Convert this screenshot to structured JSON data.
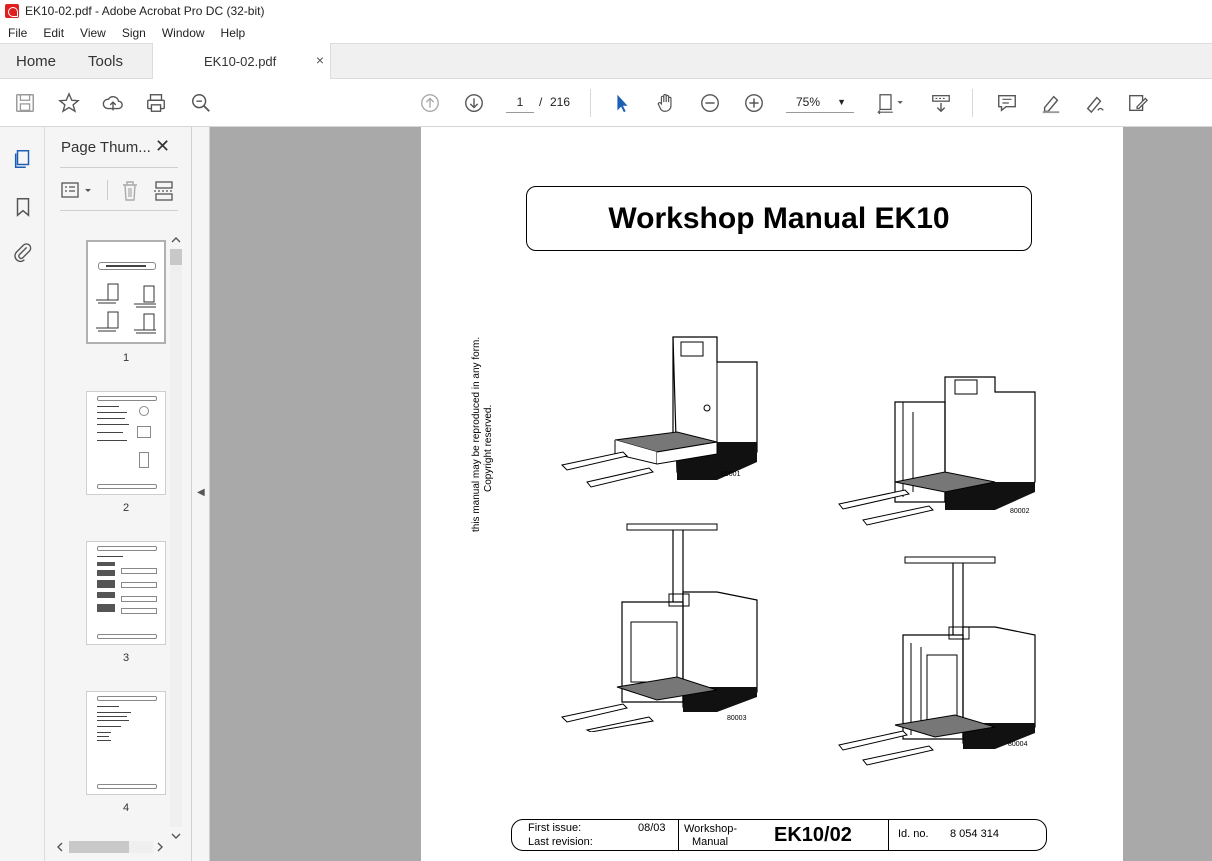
{
  "window": {
    "title": "EK10-02.pdf - Adobe Acrobat Pro DC (32-bit)"
  },
  "menu": [
    "File",
    "Edit",
    "View",
    "Sign",
    "Window",
    "Help"
  ],
  "tabs": {
    "home": "Home",
    "tools": "Tools",
    "document": "EK10-02.pdf",
    "close": "×"
  },
  "toolbar": {
    "current_page": "1",
    "page_separator": "/",
    "total_pages": "216",
    "zoom": "75%"
  },
  "thumbnails": {
    "title": "Page Thum...",
    "close": "✕",
    "pages": [
      {
        "number": "1"
      },
      {
        "number": "2"
      },
      {
        "number": "3"
      },
      {
        "number": "4"
      }
    ]
  },
  "document": {
    "title": "Workshop Manual EK10",
    "copyright_line1": "this manual may be reproduced in any form.",
    "copyright_line2": "Copyright reserved.",
    "figures": [
      {
        "label": "80001"
      },
      {
        "label": "80002"
      },
      {
        "label": "80003"
      },
      {
        "label": "80004"
      }
    ],
    "footer": {
      "first_issue_label": "First issue:",
      "first_issue_value": "08/03",
      "last_revision_label": "Last revision:",
      "doc_type_line1": "Workshop-",
      "doc_type_line2": "Manual",
      "model": "EK10/02",
      "id_label": "Id. no.",
      "id_value": "8 054 314"
    }
  }
}
